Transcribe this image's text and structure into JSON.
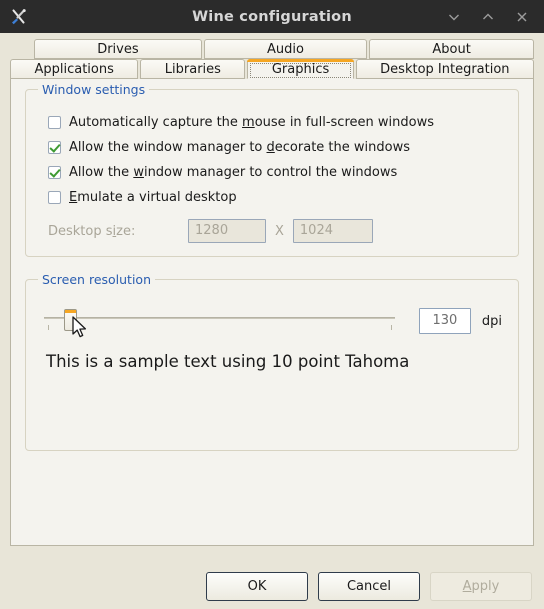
{
  "window": {
    "title": "Wine configuration",
    "icon": "tools-icon",
    "controls": [
      {
        "name": "minimize-button",
        "icon": "chevron-down-icon"
      },
      {
        "name": "maximize-button",
        "icon": "chevron-up-icon"
      },
      {
        "name": "close-button",
        "icon": "close-icon"
      }
    ]
  },
  "tabs": {
    "row1": [
      {
        "label": "Drives",
        "active": false
      },
      {
        "label": "Audio",
        "active": false
      },
      {
        "label": "About",
        "active": false
      }
    ],
    "row2": [
      {
        "label": "Applications",
        "active": false
      },
      {
        "label": "Libraries",
        "active": false
      },
      {
        "label": "Graphics",
        "active": true
      },
      {
        "label": "Desktop Integration",
        "active": false
      }
    ],
    "active_tab": "Graphics",
    "accent_color": "#f5a623"
  },
  "window_settings": {
    "title": "Window settings",
    "checkboxes": [
      {
        "label_before": "Automatically capture the ",
        "mnemonic": "m",
        "label_after": "ouse in full-screen windows",
        "checked": false
      },
      {
        "label_before": "Allow the window manager to ",
        "mnemonic": "d",
        "label_after": "ecorate the windows",
        "checked": true
      },
      {
        "label_before": "Allow the ",
        "mnemonic": "w",
        "label_after": "indow manager to control the windows",
        "checked": true
      },
      {
        "label_before": "",
        "mnemonic": "E",
        "label_after": "mulate a virtual desktop",
        "checked": false
      }
    ],
    "desktop_size": {
      "label_before": "Desktop s",
      "mnemonic": "i",
      "label_after": "ze:",
      "width_value": "1280",
      "separator": "X",
      "height_value": "1024",
      "disabled": true
    }
  },
  "screen_resolution": {
    "title": "Screen resolution",
    "slider": {
      "value": 130,
      "min": 96,
      "max": 480,
      "handle_position_percent": 8,
      "tick_positions_percent": [
        1,
        99
      ]
    },
    "dpi_value": "130",
    "dpi_unit": "dpi",
    "sample_text": "This is a sample text using 10 point Tahoma"
  },
  "buttons": {
    "ok": {
      "label": "OK",
      "disabled": false
    },
    "cancel": {
      "label": "Cancel",
      "disabled": false
    },
    "apply": {
      "mnemonic": "A",
      "label_after": "pply",
      "disabled": true
    }
  },
  "colors": {
    "titlebar_bg": "#2b2b2b",
    "dialog_bg": "#e8e5d8",
    "panel_bg": "#f4f3ee",
    "group_label": "#2a5db0",
    "accent": "#f5a623",
    "check_green": "#3f9b33"
  }
}
